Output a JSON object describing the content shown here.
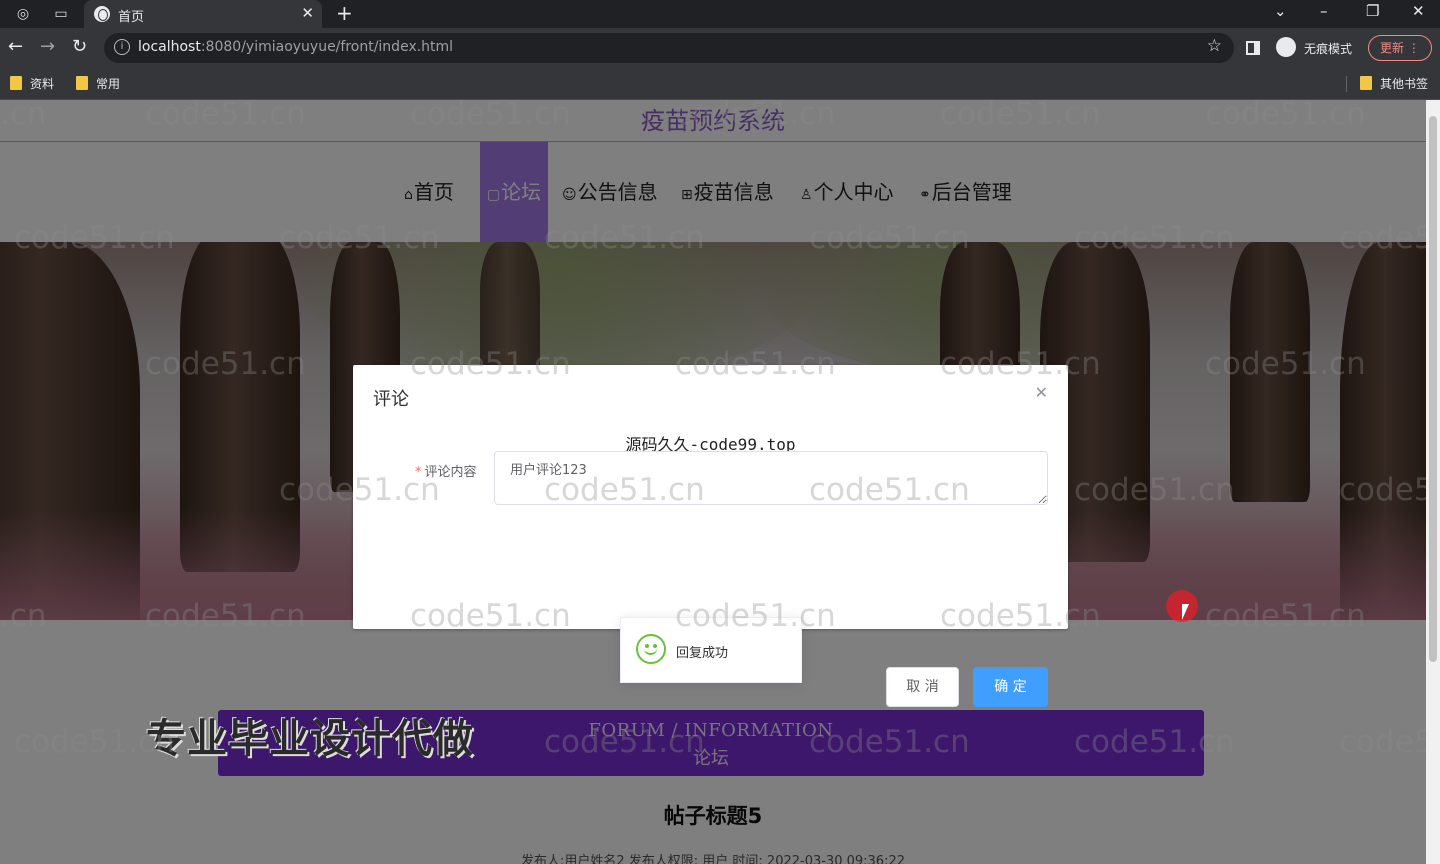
{
  "browser": {
    "tab_title": "首页",
    "url_host": "localhost",
    "url_path": ":8080/yimiaoyuyue/front/index.html",
    "incognito_label": "无痕模式",
    "update_label": "更新",
    "bookmarks": [
      "资料",
      "常用"
    ],
    "other_bookmarks": "其他书签"
  },
  "site": {
    "title": "疫苗预约系统",
    "menu": [
      {
        "label": "首页",
        "icon": "home-icon",
        "glyph": "⌂"
      },
      {
        "label": "论坛",
        "icon": "forum-icon",
        "glyph": "▢"
      },
      {
        "label": "公告信息",
        "icon": "notice-icon",
        "glyph": "☺"
      },
      {
        "label": "疫苗信息",
        "icon": "vaccine-icon",
        "glyph": "⊞"
      },
      {
        "label": "个人中心",
        "icon": "user-icon",
        "glyph": "♙"
      },
      {
        "label": "后台管理",
        "icon": "link-icon",
        "glyph": "⚭"
      }
    ],
    "active_menu": "论坛"
  },
  "section": {
    "header_en": "FORUM / INFORMATION",
    "header_cn": "论坛",
    "post_title": "帖子标题5",
    "post_meta": "发布人:用户姓名2  发布人权限: 用户  时间: 2022-03-30 09:36:22"
  },
  "promo_text": "专业毕业设计代做",
  "dialog": {
    "title": "评论",
    "note": "源码久久-code99.top",
    "field_label": "评论内容",
    "field_value": "用户评论123",
    "cancel_label": "取 消",
    "confirm_label": "确 定"
  },
  "toast": {
    "message": "回复成功",
    "icon": "success-smile-icon"
  },
  "watermark_text": "code51.cn",
  "colors": {
    "accent_purple": "#a47be8",
    "forum_header": "#7a2fd6",
    "primary_button": "#409eff",
    "success": "#67c23a"
  }
}
